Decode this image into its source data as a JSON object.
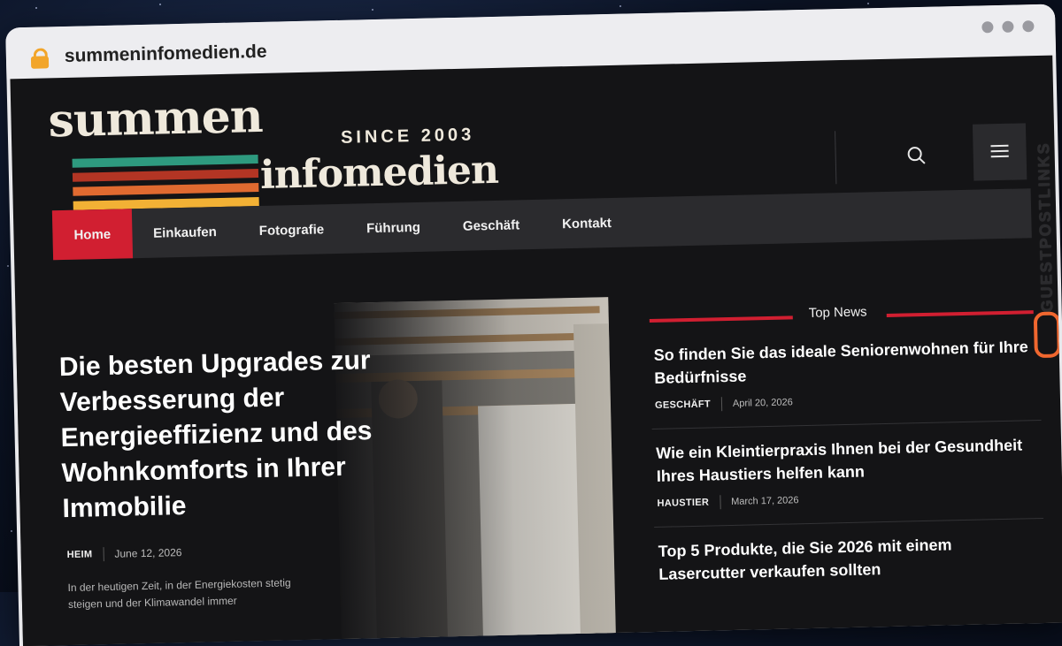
{
  "browser": {
    "url": "summeninfomedien.de"
  },
  "logo": {
    "line1": "summen",
    "since": "SINCE 2003",
    "line2": "infomedien",
    "stripe_colors": [
      "#2e9a7f",
      "#b33524",
      "#e06a30",
      "#f2b135"
    ]
  },
  "nav": {
    "items": [
      "Home",
      "Einkaufen",
      "Fotografie",
      "Führung",
      "Geschäft",
      "Kontakt"
    ],
    "active_index": 0
  },
  "hero": {
    "title": "Die besten Upgrades zur Verbesserung der Energieeffizienz und des Wohnkomforts in Ihrer Immobilie",
    "category": "HEIM",
    "date": "June 12, 2026",
    "excerpt": "In der heutigen Zeit, in der Energiekosten stetig steigen und der Klimawandel immer"
  },
  "top_news": {
    "heading": "Top News",
    "items": [
      {
        "title": "So finden Sie das ideale Seniorenwohnen für Ihre Bedürfnisse",
        "category": "GESCHÄFT",
        "date": "April 20, 2026"
      },
      {
        "title": "Wie ein Kleintierpraxis Ihnen bei der Gesundheit Ihres Haustiers helfen kann",
        "category": "HAUSTIER",
        "date": "March 17, 2026"
      },
      {
        "title": "Top 5 Produkte, die Sie 2026 mit einem Lasercutter verkaufen sollten",
        "category": "",
        "date": ""
      }
    ]
  },
  "watermark": {
    "text": "GUESTPOSTLINKS"
  },
  "colors": {
    "accent": "#d11f31",
    "page_bg": "#141416",
    "nav_bg": "#2b2b2e"
  }
}
